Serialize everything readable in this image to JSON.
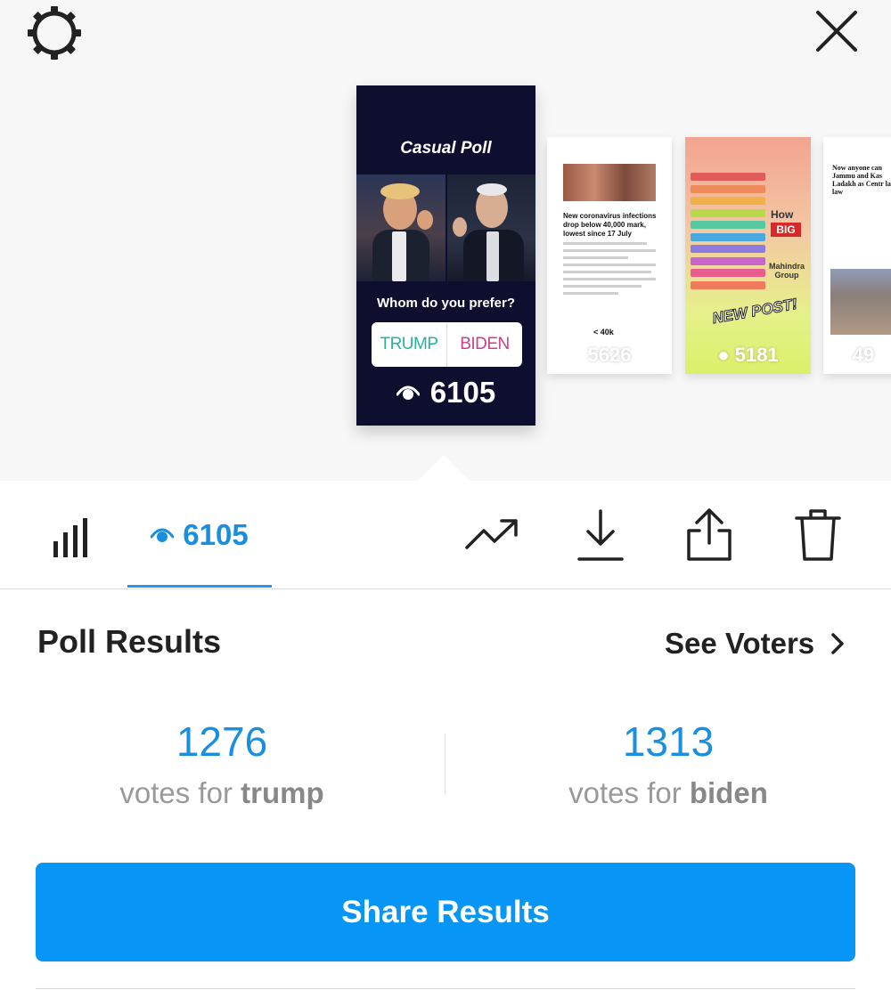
{
  "story": {
    "poll_title": "Casual Poll",
    "question": "Whom do you prefer?",
    "option_a": "TRUMP",
    "option_b": "BIDEN",
    "views": "6105"
  },
  "thumbnails": [
    {
      "headline": "New coronavirus infections drop below 40,000 mark, lowest since 17 July",
      "tag": "< 40k",
      "views": "5626"
    },
    {
      "how": "How",
      "big": "BIG",
      "brand_line1": "Mahindra",
      "brand_line2": "Group",
      "badge": "NEW POST!",
      "views": "5181"
    },
    {
      "headline": "Now anyone can Jammu and Kas Ladakh as Centr land law",
      "views": "49"
    }
  ],
  "tabs": {
    "views_count": "6105"
  },
  "results": {
    "title": "Poll Results",
    "see_voters": "See Voters",
    "left": {
      "count": "1276",
      "prefix": "votes for ",
      "name": "trump"
    },
    "right": {
      "count": "1313",
      "prefix": "votes for ",
      "name": "biden"
    }
  },
  "share_button": "Share Results",
  "colors": {
    "accent": "#0795f6",
    "tab_accent": "#2196f3",
    "story_bg": "#0e0e2e",
    "trump": "#27b3a0",
    "biden": "#c9408a"
  }
}
